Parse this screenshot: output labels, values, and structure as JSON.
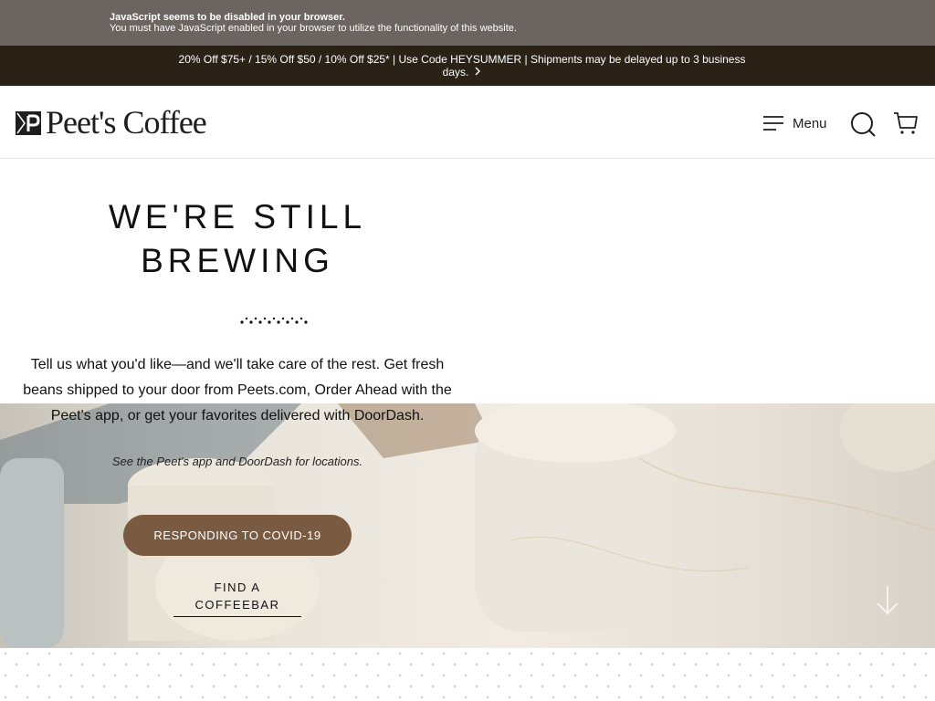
{
  "noscript": {
    "title": "JavaScript seems to be disabled in your browser.",
    "message": "You must have JavaScript enabled in your browser to utilize the functionality of this website."
  },
  "promo": {
    "text": "20% Off $75+ / 15% Off $50 / 10% Off $25* | Use Code HEYSUMMER | Shipments may be delayed up to 3 business days.",
    "icon": "chevron-right-icon"
  },
  "header": {
    "logo_text": "Peet's Coffee",
    "menu_label": "Menu",
    "icons": [
      "hamburger-icon",
      "search-icon",
      "cart-icon"
    ]
  },
  "hero": {
    "title": "WE'RE STILL BREWING",
    "body": "Tell us what you'd like—and we'll take care of the rest. Get fresh beans shipped to your door from Peets.com, Order Ahead with the Peet's app, or get your favorites delivered with DoorDash.",
    "note": "See the Peet's app and DoorDash for locations.",
    "primary_button": "RESPONDING TO COVID-19",
    "secondary_link": "FIND A COFFEEBAR"
  },
  "colors": {
    "promo_bg": "#2a2217",
    "noscript_bg": "#6b6460",
    "button_brown": "#7a5a40"
  }
}
